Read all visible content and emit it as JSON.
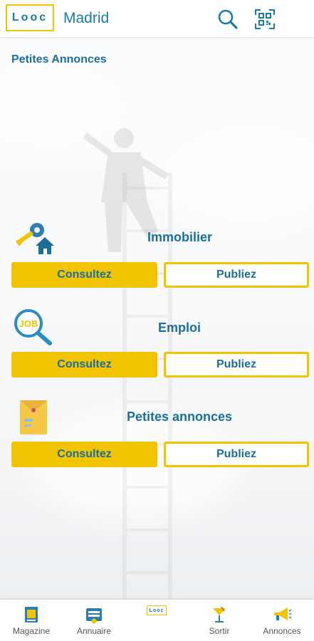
{
  "header": {
    "logo_text": "Looc",
    "city": "Madrid",
    "search_icon": "search-icon",
    "qr_icon": "qr-scan-icon"
  },
  "page": {
    "title": "Petites Annonces"
  },
  "categories": [
    {
      "name": "Immobilier",
      "icon": "key-house-icon",
      "consult_label": "Consultez",
      "publish_label": "Publiez"
    },
    {
      "name": "Emploi",
      "icon": "job-magnifier-icon",
      "consult_label": "Consultez",
      "publish_label": "Publiez"
    },
    {
      "name": "Petites annonces",
      "icon": "envelope-icon",
      "consult_label": "Consultez",
      "publish_label": "Publiez"
    }
  ],
  "bottom_nav": [
    {
      "label": "Magazine",
      "icon": "magazine-icon"
    },
    {
      "label": "Annuaire",
      "icon": "directory-icon"
    },
    {
      "label": "",
      "icon": "looc-logo-icon",
      "logo_text": "Looc"
    },
    {
      "label": "Sortir",
      "icon": "cocktail-icon"
    },
    {
      "label": "Annonces",
      "icon": "megaphone-icon"
    }
  ],
  "colors": {
    "accent": "#f2c300",
    "primary_text": "#1a6f9c"
  }
}
